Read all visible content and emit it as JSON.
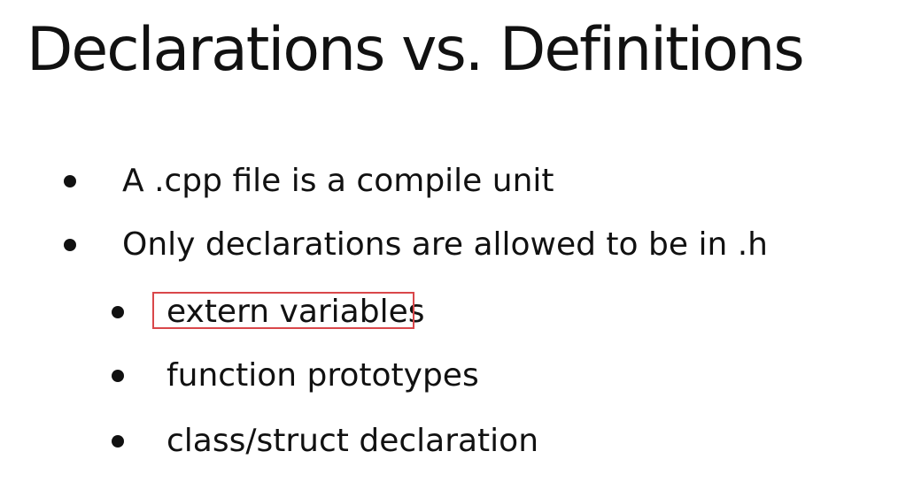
{
  "slide": {
    "title": "Declarations vs. Definitions",
    "bullets": [
      {
        "text": "A .cpp file is a compile unit",
        "level": 1
      },
      {
        "text": "Only declarations are allowed to be in .h",
        "level": 1
      },
      {
        "text": "extern variables",
        "level": 2,
        "highlighted": true
      },
      {
        "text": "function prototypes",
        "level": 2
      },
      {
        "text": "class/struct declaration",
        "level": 2
      }
    ],
    "highlight_color": "#d9474a"
  }
}
